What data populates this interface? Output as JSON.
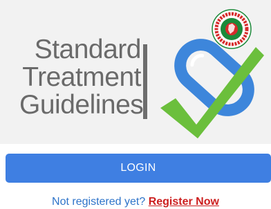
{
  "colors": {
    "banner_bg": "#f2f2f2",
    "title_text": "#6a6a6a",
    "capsule_blue": "#3d86db",
    "checkmark_green": "#6bbf3c",
    "login_button_bg": "#3f7fe2",
    "login_button_text": "#ffffff",
    "prompt_text": "#2d73c9",
    "register_link": "#cc1f1f",
    "seal_red": "#d62b2b",
    "seal_green": "#1c8a3a"
  },
  "banner": {
    "title_lines": [
      "Standard",
      "Treatment",
      "Guidelines"
    ],
    "logo_icon": "capsule-checkmark-icon",
    "seal_icon": "bangladesh-government-seal-icon",
    "seal_text_top": "গণপ্রজাতন্ত্রী বাংলাদেশ",
    "seal_text_bottom": "সরকার"
  },
  "login": {
    "button_label": "LOGIN"
  },
  "register": {
    "prompt": "Not registered yet?",
    "link_label": "Register Now"
  }
}
